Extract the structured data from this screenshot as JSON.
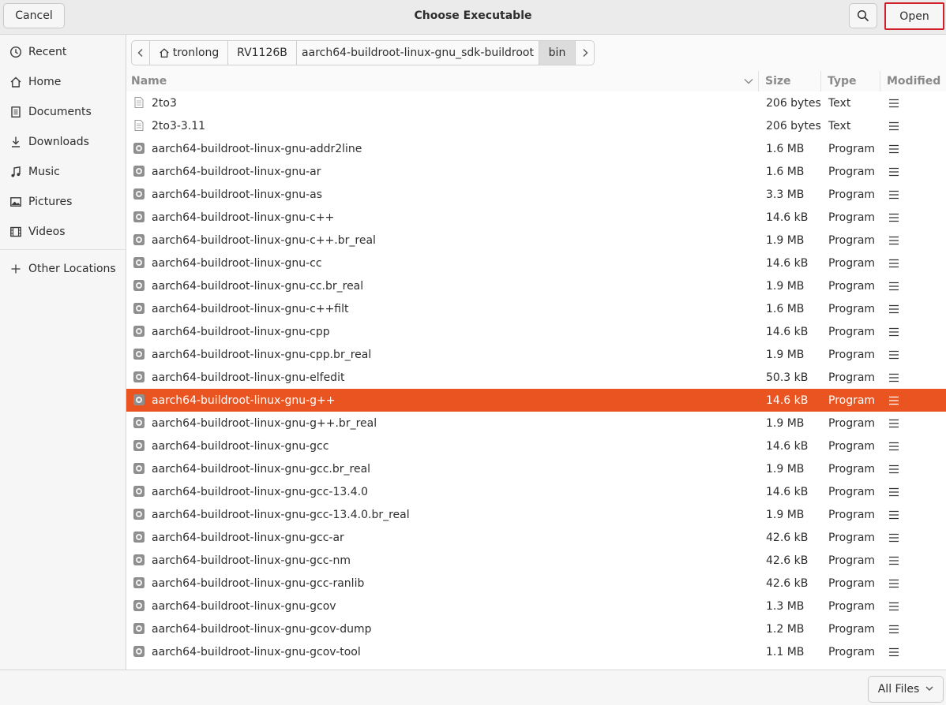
{
  "header": {
    "title": "Choose Executable",
    "cancel_label": "Cancel",
    "open_label": "Open",
    "search_icon": "search-icon"
  },
  "sidebar": {
    "items": [
      {
        "label": "Recent",
        "icon": "clock-icon"
      },
      {
        "label": "Home",
        "icon": "home-icon"
      },
      {
        "label": "Documents",
        "icon": "document-icon"
      },
      {
        "label": "Downloads",
        "icon": "download-icon"
      },
      {
        "label": "Music",
        "icon": "music-icon"
      },
      {
        "label": "Pictures",
        "icon": "picture-icon"
      },
      {
        "label": "Videos",
        "icon": "video-icon"
      },
      {
        "label": "Other Locations",
        "icon": "plus-icon"
      }
    ]
  },
  "pathbar": {
    "segments": [
      "tronlong",
      "RV1126B",
      "aarch64-buildroot-linux-gnu_sdk-buildroot",
      "bin"
    ],
    "active": "bin"
  },
  "columns": {
    "name": "Name",
    "size": "Size",
    "type": "Type",
    "modified": "Modified"
  },
  "files": [
    {
      "name": "2to3",
      "size": "206 bytes",
      "type": "Text"
    },
    {
      "name": "2to3-3.11",
      "size": "206 bytes",
      "type": "Text"
    },
    {
      "name": "aarch64-buildroot-linux-gnu-addr2line",
      "size": "1.6 MB",
      "type": "Program"
    },
    {
      "name": "aarch64-buildroot-linux-gnu-ar",
      "size": "1.6 MB",
      "type": "Program"
    },
    {
      "name": "aarch64-buildroot-linux-gnu-as",
      "size": "3.3 MB",
      "type": "Program"
    },
    {
      "name": "aarch64-buildroot-linux-gnu-c++",
      "size": "14.6 kB",
      "type": "Program"
    },
    {
      "name": "aarch64-buildroot-linux-gnu-c++.br_real",
      "size": "1.9 MB",
      "type": "Program"
    },
    {
      "name": "aarch64-buildroot-linux-gnu-cc",
      "size": "14.6 kB",
      "type": "Program"
    },
    {
      "name": "aarch64-buildroot-linux-gnu-cc.br_real",
      "size": "1.9 MB",
      "type": "Program"
    },
    {
      "name": "aarch64-buildroot-linux-gnu-c++filt",
      "size": "1.6 MB",
      "type": "Program"
    },
    {
      "name": "aarch64-buildroot-linux-gnu-cpp",
      "size": "14.6 kB",
      "type": "Program"
    },
    {
      "name": "aarch64-buildroot-linux-gnu-cpp.br_real",
      "size": "1.9 MB",
      "type": "Program"
    },
    {
      "name": "aarch64-buildroot-linux-gnu-elfedit",
      "size": "50.3 kB",
      "type": "Program"
    },
    {
      "name": "aarch64-buildroot-linux-gnu-g++",
      "size": "14.6 kB",
      "type": "Program",
      "selected": true
    },
    {
      "name": "aarch64-buildroot-linux-gnu-g++.br_real",
      "size": "1.9 MB",
      "type": "Program"
    },
    {
      "name": "aarch64-buildroot-linux-gnu-gcc",
      "size": "14.6 kB",
      "type": "Program"
    },
    {
      "name": "aarch64-buildroot-linux-gnu-gcc.br_real",
      "size": "1.9 MB",
      "type": "Program"
    },
    {
      "name": "aarch64-buildroot-linux-gnu-gcc-13.4.0",
      "size": "14.6 kB",
      "type": "Program"
    },
    {
      "name": "aarch64-buildroot-linux-gnu-gcc-13.4.0.br_real",
      "size": "1.9 MB",
      "type": "Program"
    },
    {
      "name": "aarch64-buildroot-linux-gnu-gcc-ar",
      "size": "42.6 kB",
      "type": "Program"
    },
    {
      "name": "aarch64-buildroot-linux-gnu-gcc-nm",
      "size": "42.6 kB",
      "type": "Program"
    },
    {
      "name": "aarch64-buildroot-linux-gnu-gcc-ranlib",
      "size": "42.6 kB",
      "type": "Program"
    },
    {
      "name": "aarch64-buildroot-linux-gnu-gcov",
      "size": "1.3 MB",
      "type": "Program"
    },
    {
      "name": "aarch64-buildroot-linux-gnu-gcov-dump",
      "size": "1.2 MB",
      "type": "Program"
    },
    {
      "name": "aarch64-buildroot-linux-gnu-gcov-tool",
      "size": "1.1 MB",
      "type": "Program"
    }
  ],
  "footer": {
    "filter_label": "All Files"
  },
  "colors": {
    "accent": "#e95420",
    "highlight_border": "#d0202a"
  }
}
